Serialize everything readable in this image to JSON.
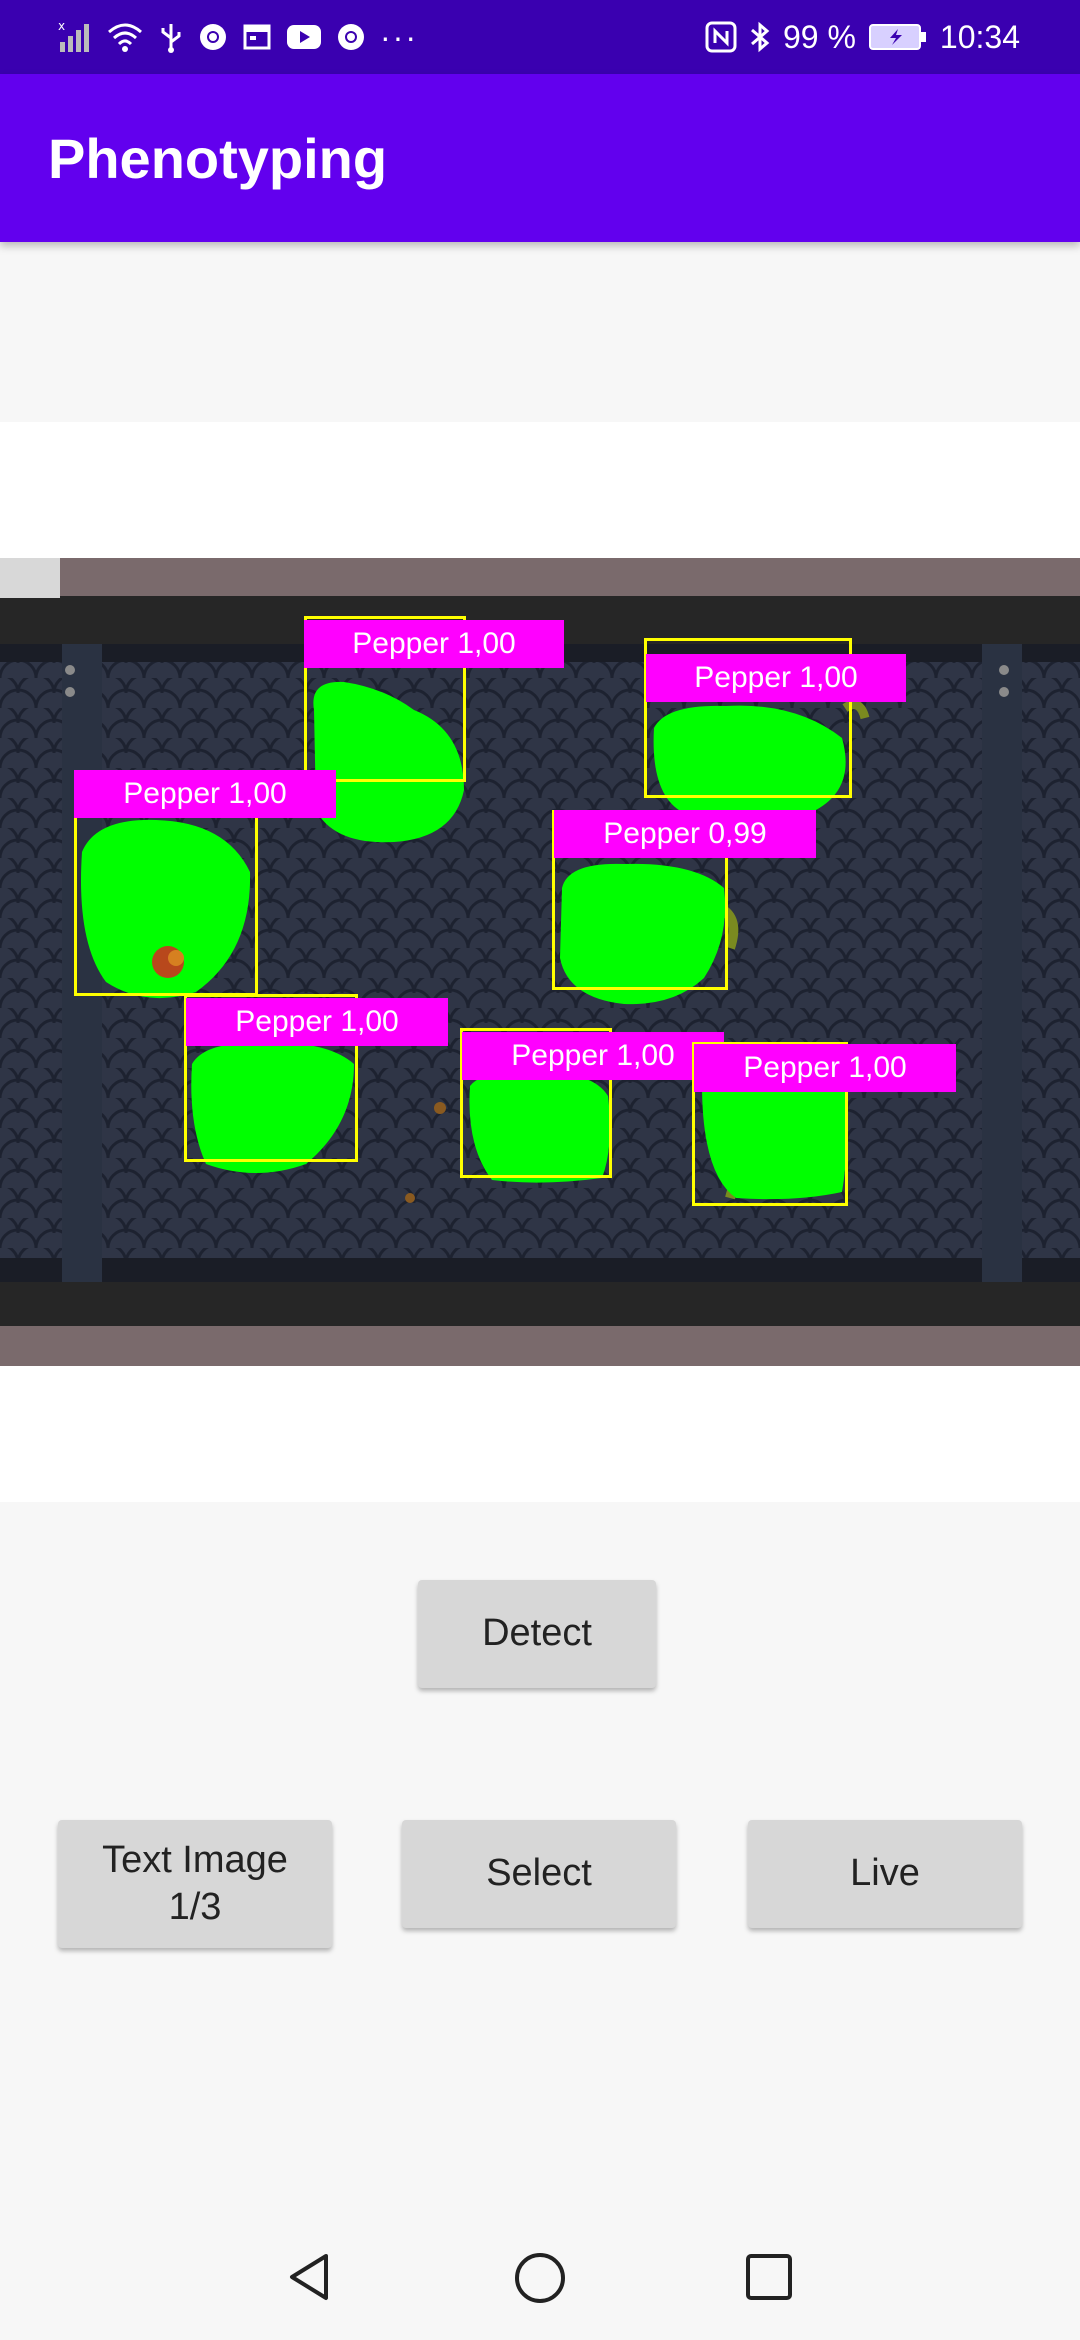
{
  "status_bar": {
    "battery": "99 %",
    "time": "10:34",
    "icons": [
      "signal-icon",
      "wifi-icon",
      "usb-icon",
      "chrome-icon",
      "calendar-icon",
      "youtube-icon",
      "chrome-icon",
      "more-notifications-icon",
      "nfc-icon",
      "bluetooth-icon",
      "battery-icon"
    ],
    "more": "···"
  },
  "app_bar": {
    "title": "Phenotyping"
  },
  "detections": [
    {
      "label": "Pepper 1,00"
    },
    {
      "label": "Pepper 1,00"
    },
    {
      "label": "Pepper 1,00"
    },
    {
      "label": "Pepper 0,99"
    },
    {
      "label": "Pepper 1,00"
    },
    {
      "label": "Pepper 1,00"
    },
    {
      "label": "Pepper 1,00"
    }
  ],
  "colors": {
    "status_bar": "#3a00b0",
    "app_bar": "#6200ee",
    "mask": "#00ff00",
    "box": "#ffff00",
    "label_bg": "#ff00ff",
    "button_bg": "#d7d7d7"
  },
  "buttons": {
    "detect": "Detect",
    "text_image_line1": "Text Image",
    "text_image_line2": "1/3",
    "select": "Select",
    "live": "Live"
  },
  "nav": {
    "back_icon": "back-triangle-icon",
    "home_icon": "home-circle-icon",
    "recents_icon": "recents-square-icon"
  }
}
